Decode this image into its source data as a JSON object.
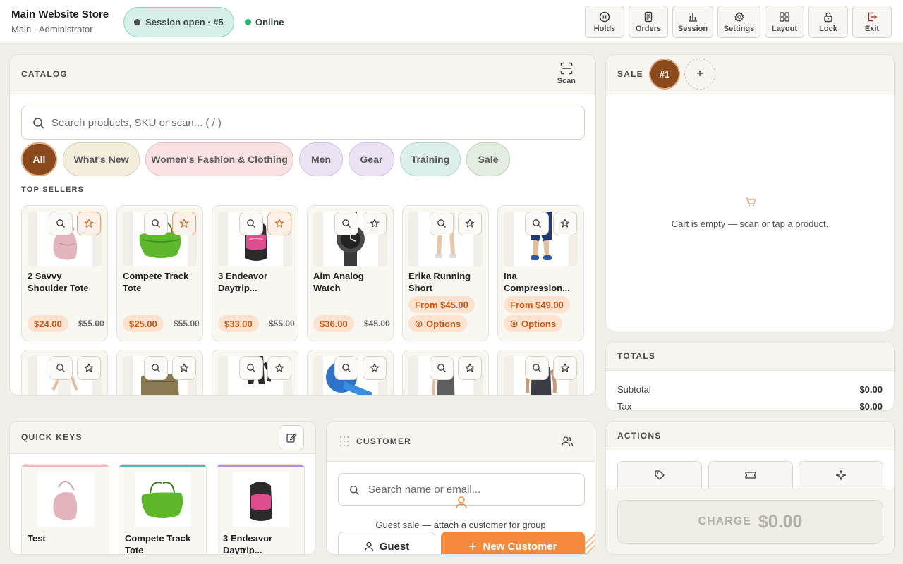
{
  "header": {
    "store_name": "Main Website Store",
    "store_sub": "Main · Administrator",
    "session": "Session open · #5",
    "status": "Online",
    "buttons": [
      {
        "label": "Holds",
        "icon": "pause-icon"
      },
      {
        "label": "Orders",
        "icon": "receipt-icon"
      },
      {
        "label": "Session",
        "icon": "bar-chart-icon"
      },
      {
        "label": "Settings",
        "icon": "gear-icon"
      },
      {
        "label": "Layout",
        "icon": "grid-icon"
      },
      {
        "label": "Lock",
        "icon": "lock-icon"
      },
      {
        "label": "Exit",
        "icon": "exit-icon"
      }
    ]
  },
  "catalog": {
    "title": "CATALOG",
    "scan_label": "Scan",
    "search_placeholder": "Search products, SKU or scan... ( / )",
    "categories": [
      {
        "label": "All",
        "color": "#8b4a1c"
      },
      {
        "label": "What's New",
        "color": "#f3eddc"
      },
      {
        "label": "Women's Fashion & Clothing",
        "color": "#f9e1e4"
      },
      {
        "label": "Men",
        "color": "#ebe3f4"
      },
      {
        "label": "Gear",
        "color": "#ebe3f4"
      },
      {
        "label": "Training",
        "color": "#dcefec"
      },
      {
        "label": "Sale",
        "color": "#e2ede0"
      }
    ],
    "section_title": "TOP SELLERS",
    "products": [
      {
        "name": "2 Savvy Shoulder Tote",
        "price": "$24.00",
        "old": "$55.00",
        "fav": true
      },
      {
        "name": "Compete Track Tote",
        "price": "$25.00",
        "old": "$55.00",
        "fav": true
      },
      {
        "name": "3 Endeavor Daytrip...",
        "price": "$33.00",
        "old": "$55.00",
        "fav": true
      },
      {
        "name": "Aim Analog Watch",
        "price": "$36.00",
        "old": "$45.00",
        "fav": false
      },
      {
        "name": "Erika Running Short",
        "from": "From $45.00",
        "options": "Options",
        "fav": false
      },
      {
        "name": "Ina Compression...",
        "from": "From $49.00",
        "options": "Options",
        "fav": false
      }
    ]
  },
  "sale": {
    "title": "SALE",
    "active": "#1",
    "add": "+",
    "empty": "Cart is empty — scan or tap a product."
  },
  "totals": {
    "title": "TOTALS",
    "rows": [
      {
        "label": "Subtotal",
        "value": "$0.00"
      },
      {
        "label": "Tax",
        "value": "$0.00"
      }
    ]
  },
  "actions": {
    "title": "ACTIONS",
    "charge_label": "CHARGE",
    "charge_amount": "$0.00"
  },
  "quick_keys": {
    "title": "QUICK KEYS",
    "items": [
      {
        "name": "Test",
        "color": "#f4b6c4"
      },
      {
        "name": "Compete Track Tote",
        "color": "#4bbcb2"
      },
      {
        "name": "3 Endeavor Daytrip...",
        "color": "#b58ee0"
      }
    ]
  },
  "customer": {
    "title": "CUSTOMER",
    "search_placeholder": "Search name or email...",
    "message": "Guest sale — attach a customer for group",
    "guest_label": "Guest",
    "new_label": "New Customer",
    "accent": "#f5893c"
  }
}
